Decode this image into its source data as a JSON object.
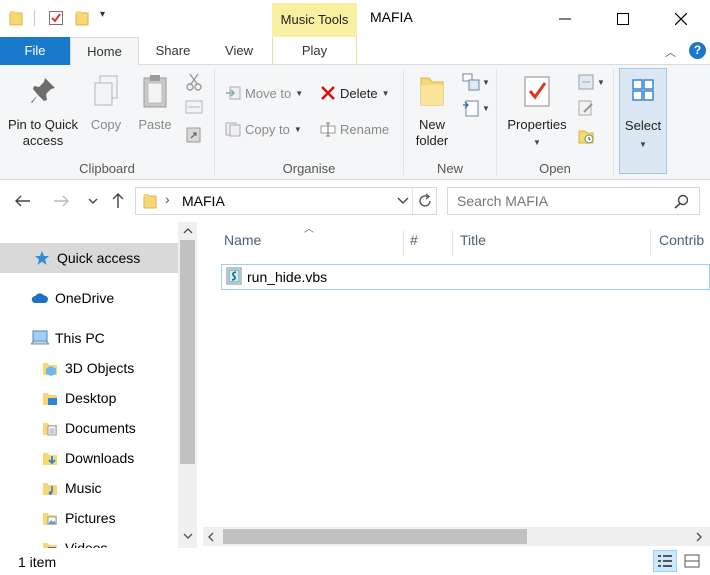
{
  "window": {
    "title": "MAFIA",
    "context_tab_title": "Music Tools"
  },
  "tabs": {
    "file": "File",
    "home": "Home",
    "share": "Share",
    "view": "View",
    "play": "Play"
  },
  "ribbon": {
    "clipboard": {
      "label": "Clipboard",
      "pin": "Pin to Quick access",
      "copy": "Copy",
      "paste": "Paste"
    },
    "organise": {
      "label": "Organise",
      "move_to": "Move to",
      "copy_to": "Copy to",
      "delete": "Delete",
      "rename": "Rename"
    },
    "new": {
      "label": "New",
      "new_folder": "New folder"
    },
    "open": {
      "label": "Open",
      "properties": "Properties"
    },
    "select": {
      "label": "Select"
    }
  },
  "address": {
    "crumb": "MAFIA",
    "search_placeholder": "Search MAFIA"
  },
  "nav": {
    "items": [
      {
        "label": "Quick access"
      },
      {
        "label": "OneDrive"
      },
      {
        "label": "This PC"
      },
      {
        "label": "3D Objects"
      },
      {
        "label": "Desktop"
      },
      {
        "label": "Documents"
      },
      {
        "label": "Downloads"
      },
      {
        "label": "Music"
      },
      {
        "label": "Pictures"
      },
      {
        "label": "Videos"
      }
    ]
  },
  "columns": {
    "name": "Name",
    "number": "#",
    "title": "Title",
    "contributing": "Contrib"
  },
  "files": [
    {
      "name": "run_hide.vbs"
    }
  ],
  "status": {
    "count": "1 item"
  },
  "colors": {
    "accent": "#1979ca",
    "context_tab": "#f6f0a0",
    "selection_border": "#99d1ff",
    "folder": "#f8d775"
  }
}
